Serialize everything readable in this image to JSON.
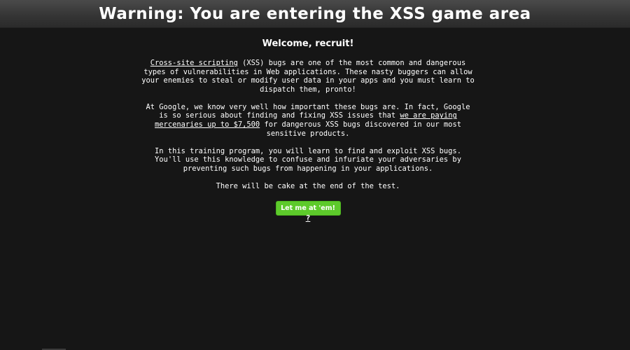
{
  "header": {
    "title": "Warning: You are entering the XSS game area"
  },
  "main": {
    "welcome": "Welcome, recruit!",
    "para1": {
      "link": "Cross-site scripting",
      "text": " (XSS) bugs are one of the most common and dangerous types of vulnerabilities in Web applications. These nasty buggers can allow your enemies to steal or modify user data in your apps and you must learn to dispatch them, pronto!"
    },
    "para2": {
      "before": "At Google, we know very well how important these bugs are. In fact, Google is so serious about finding and fixing XSS issues that ",
      "link": "we are paying mercenaries up to $7,500",
      "after": " for dangerous XSS bugs discovered in our most sensitive products."
    },
    "para3": "In this training program, you will learn to find and exploit XSS bugs. You'll use this knowledge to confuse and infuriate your adversaries by preventing such bugs from happening in your applications.",
    "para4": "There will be cake at the end of the test.",
    "cta_label": "Let me at 'em!",
    "help_label": "?"
  },
  "colors": {
    "background": "#161616",
    "header": "#3a3a3a",
    "button": "#5dca2b",
    "text": "#ffffff"
  }
}
